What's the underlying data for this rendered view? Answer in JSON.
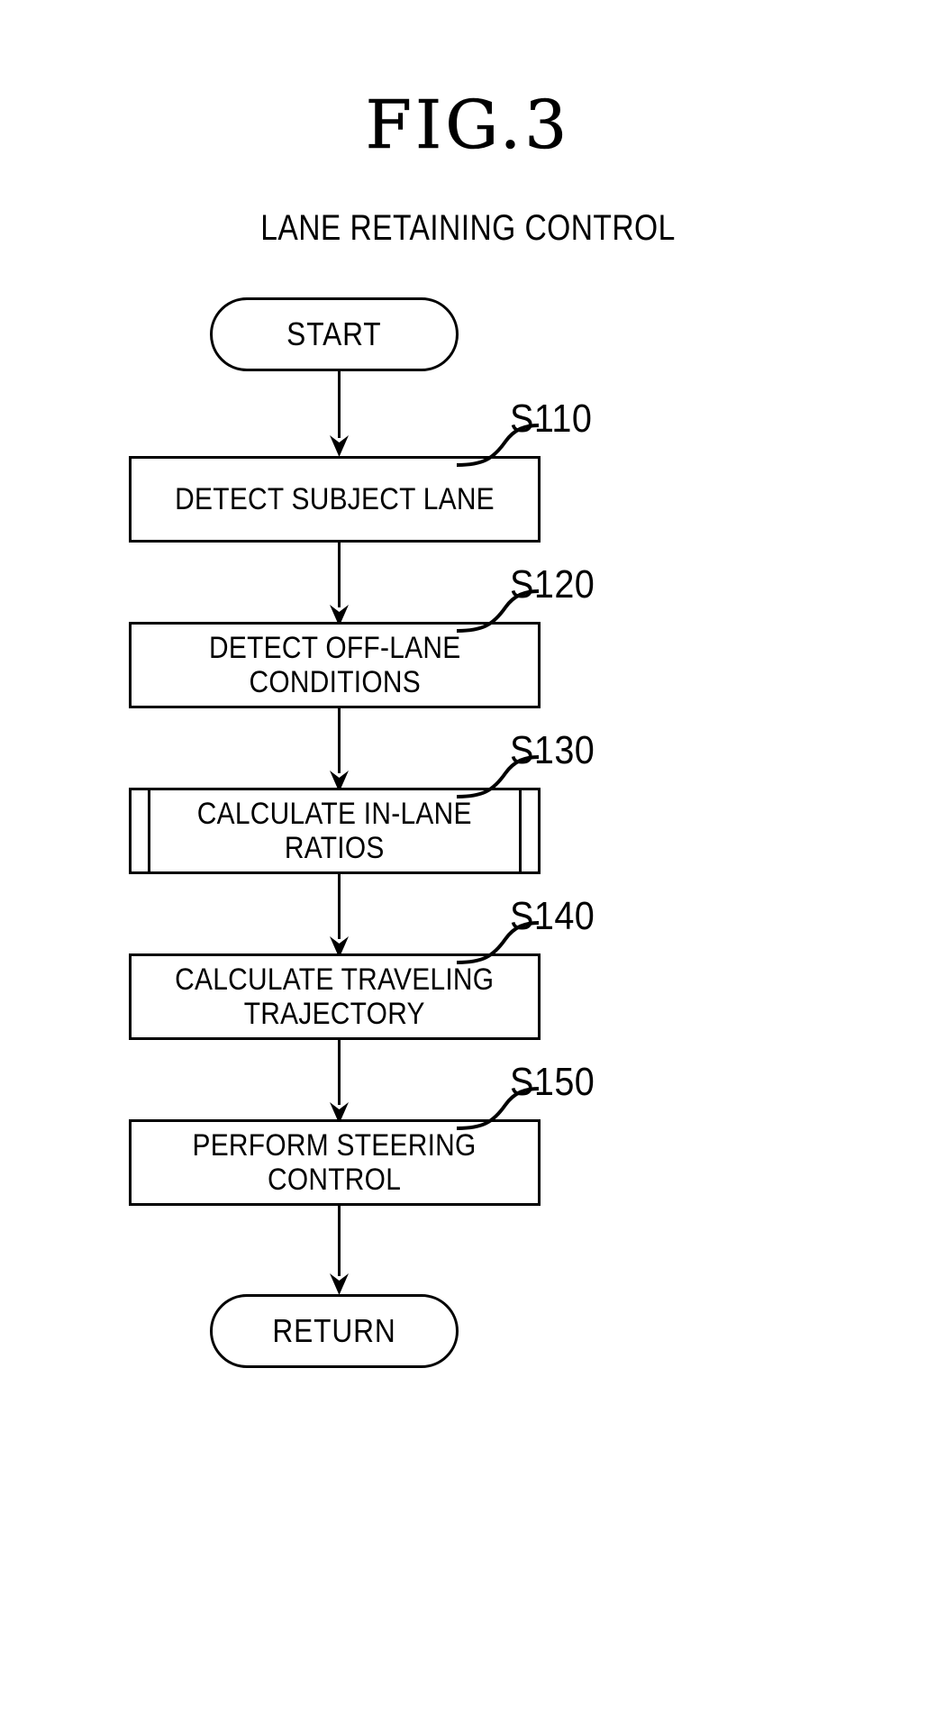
{
  "figure": {
    "title": "FIG.3",
    "subtitle": "LANE RETAINING CONTROL"
  },
  "chart_data": {
    "type": "diagram",
    "diagram_type": "flowchart",
    "title": "FIG.3",
    "subtitle": "LANE RETAINING CONTROL",
    "orientation": "top-to-bottom",
    "nodes": [
      {
        "id": "start",
        "shape": "terminator",
        "label": "START",
        "step": ""
      },
      {
        "id": "s110",
        "shape": "process",
        "label": "DETECT SUBJECT LANE",
        "step": "S110"
      },
      {
        "id": "s120",
        "shape": "process",
        "label": "DETECT OFF-LANE\nCONDITIONS",
        "step": "S120"
      },
      {
        "id": "s130",
        "shape": "predefined-process",
        "label": "CALCULATE IN-LANE\nRATIOS",
        "step": "S130"
      },
      {
        "id": "s140",
        "shape": "process",
        "label": "CALCULATE TRAVELING\nTRAJECTORY",
        "step": "S140"
      },
      {
        "id": "s150",
        "shape": "process",
        "label": "PERFORM STEERING\nCONTROL",
        "step": "S150"
      },
      {
        "id": "return",
        "shape": "terminator",
        "label": "RETURN",
        "step": ""
      }
    ],
    "edges": [
      {
        "from": "start",
        "to": "s110"
      },
      {
        "from": "s110",
        "to": "s120"
      },
      {
        "from": "s120",
        "to": "s130"
      },
      {
        "from": "s130",
        "to": "s140"
      },
      {
        "from": "s140",
        "to": "s150"
      },
      {
        "from": "s150",
        "to": "return"
      }
    ]
  },
  "nodes": {
    "start": {
      "label": "START"
    },
    "s110": {
      "label": "DETECT SUBJECT LANE",
      "step": "S110"
    },
    "s120": {
      "label": "DETECT OFF-LANE\nCONDITIONS",
      "step": "S120"
    },
    "s130": {
      "label": "CALCULATE IN-LANE\nRATIOS",
      "step": "S130"
    },
    "s140": {
      "label": "CALCULATE TRAVELING\nTRAJECTORY",
      "step": "S140"
    },
    "s150": {
      "label": "PERFORM STEERING\nCONTROL",
      "step": "S150"
    },
    "return": {
      "label": "RETURN"
    }
  },
  "colors": {
    "ink": "#000000",
    "paper": "#ffffff"
  }
}
